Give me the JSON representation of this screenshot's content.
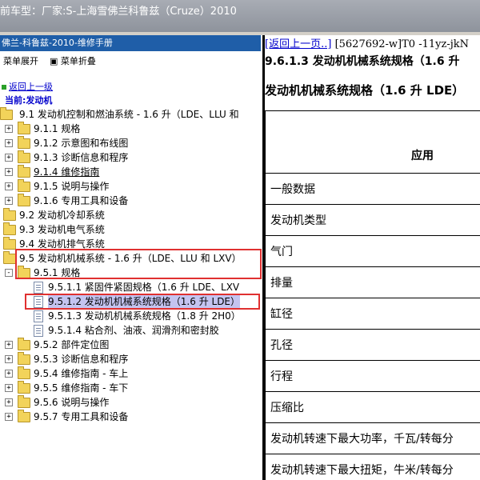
{
  "window": {
    "title": "前车型：厂家:S-上海雪佛兰科鲁兹（Cruze）2010"
  },
  "left_panel": {
    "header": "佛兰-科鲁兹-2010-维修手册",
    "expand_menu": "菜单展开",
    "collapse_menu": "菜单折叠",
    "back_link": "返回上一级",
    "current_label": "当前:发动机"
  },
  "tree": [
    {
      "label": "9.1 发动机控制和燃油系统 - 1.6 升（LDE、LLU 和",
      "icon": "folder-open-icon",
      "toggle": ""
    },
    {
      "label": "9.1.1 规格",
      "icon": "folder-icon",
      "toggle": "+"
    },
    {
      "label": "9.1.2 示意图和布线图",
      "icon": "folder-icon",
      "toggle": "+"
    },
    {
      "label": "9.1.3 诊断信息和程序",
      "icon": "folder-icon",
      "toggle": "+"
    },
    {
      "label": "9.1.4 维修指南",
      "icon": "folder-icon",
      "toggle": "+"
    },
    {
      "label": "9.1.5 说明与操作",
      "icon": "folder-icon",
      "toggle": "+"
    },
    {
      "label": "9.1.6 专用工具和设备",
      "icon": "folder-icon",
      "toggle": "+"
    },
    {
      "label": "9.2 发动机冷却系统",
      "icon": "folder-icon",
      "toggle": ""
    },
    {
      "label": "9.3 发动机电气系统",
      "icon": "folder-icon",
      "toggle": ""
    },
    {
      "label": "9.4 发动机排气系统",
      "icon": "folder-icon",
      "toggle": ""
    },
    {
      "label": "9.5 发动机机械系统 - 1.6 升（LDE、LLU 和 LXV）",
      "icon": "folder-open-icon",
      "toggle": ""
    },
    {
      "label": "9.5.1 规格",
      "icon": "folder-open-icon",
      "toggle": "-"
    },
    {
      "label": "9.5.1.1 紧固件紧固规格（1.6 升 LDE、LXV",
      "icon": "document-icon",
      "toggle": ""
    },
    {
      "label": "9.5.1.2 发动机机械系统规格（1.6 升 LDE）",
      "icon": "document-icon",
      "toggle": ""
    },
    {
      "label": "9.5.1.3 发动机机械系统规格（1.8 升 2H0）",
      "icon": "document-icon",
      "toggle": ""
    },
    {
      "label": "9.5.1.4 粘合剂、油液、润滑剂和密封胶",
      "icon": "document-icon",
      "toggle": ""
    },
    {
      "label": "9.5.2 部件定位图",
      "icon": "folder-icon",
      "toggle": "+"
    },
    {
      "label": "9.5.3 诊断信息和程序",
      "icon": "folder-icon",
      "toggle": "+"
    },
    {
      "label": "9.5.4 维修指南 - 车上",
      "icon": "folder-icon",
      "toggle": "+"
    },
    {
      "label": "9.5.5 维修指南 - 车下",
      "icon": "folder-icon",
      "toggle": "+"
    },
    {
      "label": "9.5.6 说明与操作",
      "icon": "folder-icon",
      "toggle": "+"
    },
    {
      "label": "9.5.7 专用工具和设备",
      "icon": "folder-icon",
      "toggle": "+"
    }
  ],
  "right_panel": {
    "back_link": "[返回上一页..]",
    "doc_id": "[5627692-w]T0 -11yz-jkN",
    "heading": "9.6.1.3 发动机机械系统规格（1.6 升",
    "subheading": "发动机机械系统规格（1.6 升 LDE）",
    "table_header": "应用",
    "rows": [
      "一般数据",
      "发动机类型",
      "气门",
      "排量",
      "缸径",
      "孔径",
      "行程",
      "压缩比",
      "发动机转速下最大功率，千瓦/转每分",
      "发动机转速下最大扭矩，牛米/转每分"
    ]
  },
  "colors": {
    "highlight": "#e03030",
    "selected_bg": "#c4c4f0",
    "header_bg": "#1f5ea8"
  }
}
